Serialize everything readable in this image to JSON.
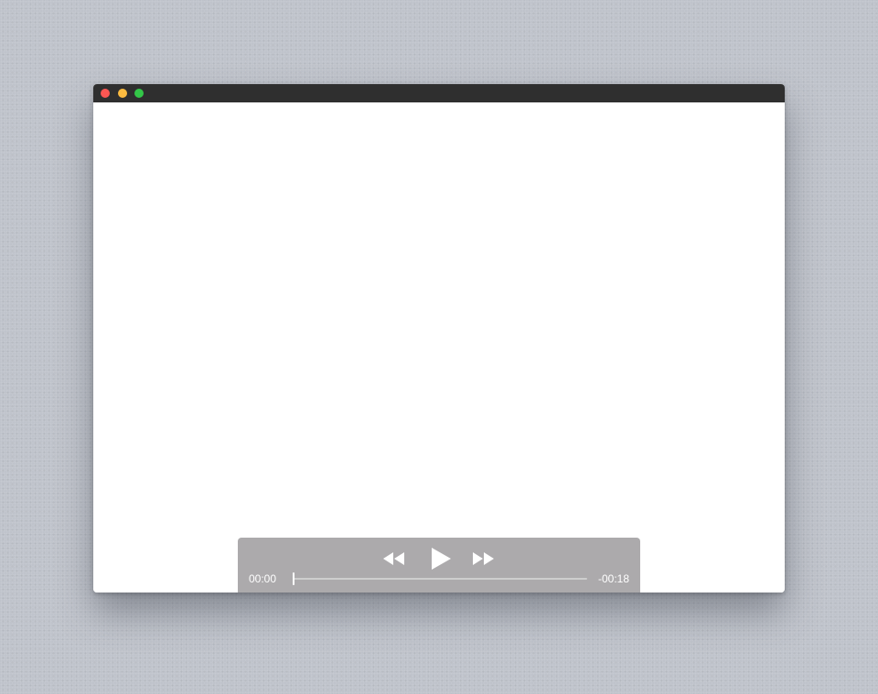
{
  "window": {
    "traffic_lights": {
      "close": {
        "icon": "close-dot-icon",
        "color": "#fc5753"
      },
      "minimize": {
        "icon": "minimize-dot-icon",
        "color": "#fdbc40"
      },
      "zoom": {
        "icon": "zoom-dot-icon",
        "color": "#33c748"
      }
    },
    "titlebar_color": "#2f2f2f",
    "content_color": "#ffffff"
  },
  "player": {
    "controls": {
      "rewind_icon": "rewind-icon",
      "play_icon": "play-icon",
      "forward_icon": "fast-forward-icon"
    },
    "elapsed": "00:00",
    "remaining": "-00:18",
    "progress": 0.0
  }
}
